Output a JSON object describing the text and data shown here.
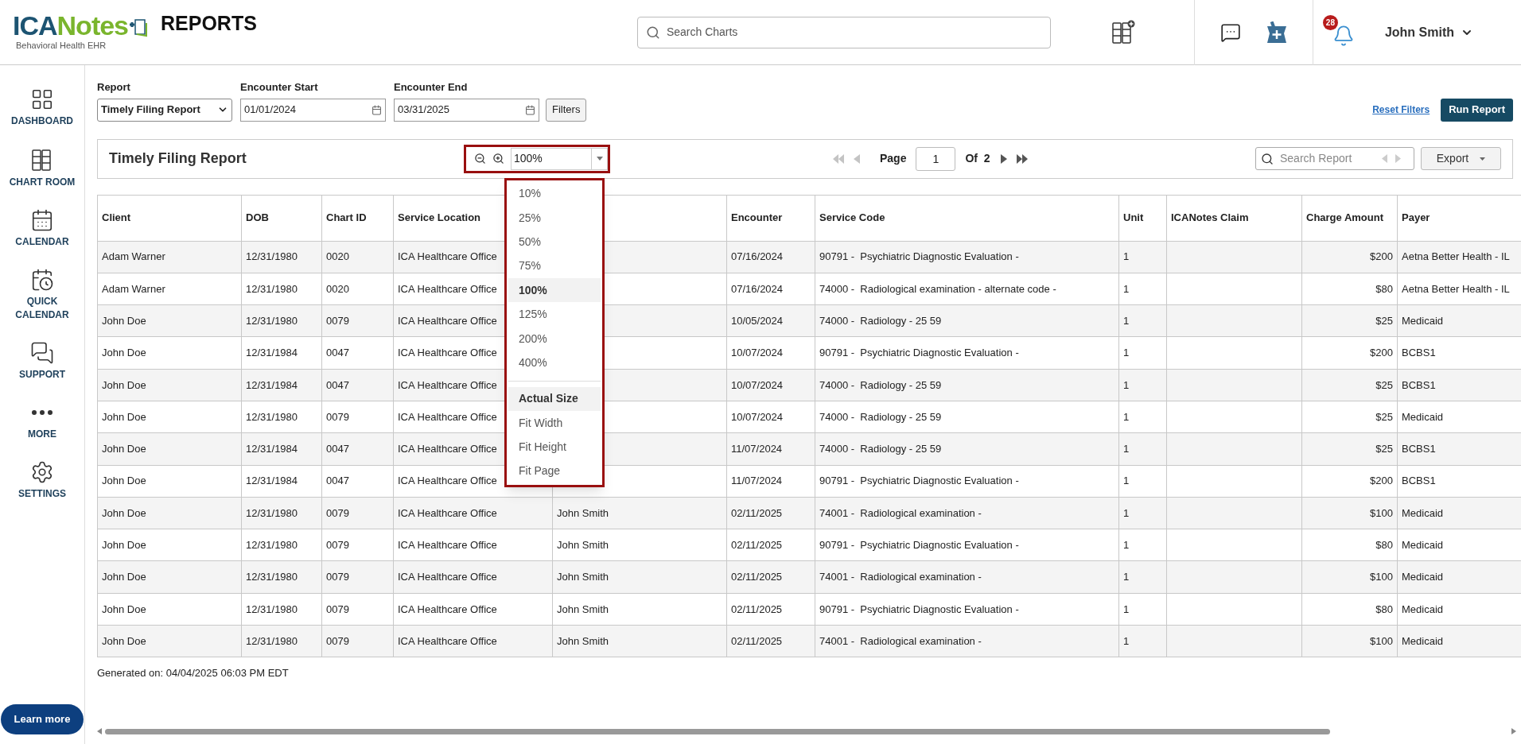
{
  "header": {
    "logo_part1": "ICA",
    "logo_part2": "Notes",
    "logo_sub": "Behavioral Health EHR",
    "title": "REPORTS",
    "search": {
      "placeholder": "Search Charts"
    },
    "notification_count": "28",
    "user": "John Smith"
  },
  "sidebar": {
    "items": [
      {
        "kind": "dashboard",
        "label": "DASHBOARD"
      },
      {
        "kind": "cabinet",
        "label": "CHART ROOM"
      },
      {
        "kind": "calendar",
        "label": "CALENDAR"
      },
      {
        "kind": "quick",
        "label": "QUICK CALENDAR"
      },
      {
        "kind": "support",
        "label": "SUPPORT"
      },
      {
        "kind": "more",
        "label": "MORE"
      },
      {
        "kind": "settings",
        "label": "SETTINGS"
      }
    ],
    "learn_more": "Learn more"
  },
  "filters": {
    "report": {
      "label": "Report",
      "value": "Timely Filing Report"
    },
    "encounter_start": {
      "label": "Encounter Start",
      "value": "01/01/2024"
    },
    "encounter_end": {
      "label": "Encounter End",
      "value": "03/31/2025"
    },
    "filters_button": "Filters",
    "reset_link": "Reset Filters",
    "run_button": "Run Report"
  },
  "report": {
    "title": "Timely Filing Report",
    "zoom_value": "100%",
    "zoom_menu": {
      "levels": [
        {
          "label": "10%",
          "selected": false
        },
        {
          "label": "25%",
          "selected": false
        },
        {
          "label": "50%",
          "selected": false
        },
        {
          "label": "75%",
          "selected": false
        },
        {
          "label": "100%",
          "selected": true
        },
        {
          "label": "125%",
          "selected": false
        },
        {
          "label": "200%",
          "selected": false
        },
        {
          "label": "400%",
          "selected": false
        }
      ],
      "fits": [
        {
          "label": "Actual Size",
          "selected": true
        },
        {
          "label": "Fit Width",
          "selected": false
        },
        {
          "label": "Fit Height",
          "selected": false
        },
        {
          "label": "Fit Page",
          "selected": false
        }
      ]
    },
    "pager": {
      "page_label": "Page",
      "page": "1",
      "of_label": "Of",
      "total": "2"
    },
    "search": {
      "placeholder": "Search Report"
    },
    "export": "Export"
  },
  "table": {
    "columns": [
      "Client",
      "DOB",
      "Chart ID",
      "Service Location",
      null,
      "Encounter",
      "Service Code",
      "Unit",
      "ICANotes Claim",
      "Charge Amount",
      "Payer"
    ],
    "rows": [
      [
        "Adam Warner",
        "12/31/1980",
        "0020",
        "ICA Healthcare Office",
        null,
        "07/16/2024",
        "90791 -  Psychiatric Diagnostic Evaluation -",
        "1",
        null,
        "$200",
        "Aetna Better Health - IL"
      ],
      [
        "Adam Warner",
        "12/31/1980",
        "0020",
        "ICA Healthcare Office",
        null,
        "07/16/2024",
        "74000 -  Radiological examination - alternate code -",
        "1",
        null,
        "$80",
        "Aetna Better Health - IL"
      ],
      [
        "John Doe",
        "12/31/1980",
        "0079",
        "ICA Healthcare Office",
        null,
        "10/05/2024",
        "74000 -  Radiology - 25 59",
        "1",
        null,
        "$25",
        "Medicaid"
      ],
      [
        "John Doe",
        "12/31/1984",
        "0047",
        "ICA Healthcare Office",
        null,
        "10/07/2024",
        "90791 -  Psychiatric Diagnostic Evaluation -",
        "1",
        null,
        "$200",
        "BCBS1"
      ],
      [
        "John Doe",
        "12/31/1984",
        "0047",
        "ICA Healthcare Office",
        null,
        "10/07/2024",
        "74000 -  Radiology - 25 59",
        "1",
        null,
        "$25",
        "BCBS1"
      ],
      [
        "John Doe",
        "12/31/1980",
        "0079",
        "ICA Healthcare Office",
        null,
        "10/07/2024",
        "74000 -  Radiology - 25 59",
        "1",
        null,
        "$25",
        "Medicaid"
      ],
      [
        "John Doe",
        "12/31/1984",
        "0047",
        "ICA Healthcare Office",
        null,
        "11/07/2024",
        "74000 -  Radiology - 25 59",
        "1",
        null,
        "$25",
        "BCBS1"
      ],
      [
        "John Doe",
        "12/31/1984",
        "0047",
        "ICA Healthcare Office",
        null,
        "11/07/2024",
        "90791 -  Psychiatric Diagnostic Evaluation -",
        "1",
        null,
        "$200",
        "BCBS1"
      ],
      [
        "John Doe",
        "12/31/1980",
        "0079",
        "ICA Healthcare Office",
        "John Smith",
        "02/11/2025",
        "74001 -  Radiological examination -",
        "1",
        null,
        "$100",
        "Medicaid"
      ],
      [
        "John Doe",
        "12/31/1980",
        "0079",
        "ICA Healthcare Office",
        "John Smith",
        "02/11/2025",
        "90791 -  Psychiatric Diagnostic Evaluation -",
        "1",
        null,
        "$80",
        "Medicaid"
      ],
      [
        "John Doe",
        "12/31/1980",
        "0079",
        "ICA Healthcare Office",
        "John Smith",
        "02/11/2025",
        "74001 -  Radiological examination -",
        "1",
        null,
        "$100",
        "Medicaid"
      ],
      [
        "John Doe",
        "12/31/1980",
        "0079",
        "ICA Healthcare Office",
        "John Smith",
        "02/11/2025",
        "90791 -  Psychiatric Diagnostic Evaluation -",
        "1",
        null,
        "$80",
        "Medicaid"
      ],
      [
        "John Doe",
        "12/31/1980",
        "0079",
        "ICA Healthcare Office",
        "John Smith",
        "02/11/2025",
        "74001 -  Radiological examination -",
        "1",
        null,
        "$100",
        "Medicaid"
      ]
    ]
  },
  "footer": {
    "generated": "Generated on: 04/04/2025 06:03 PM EDT"
  }
}
